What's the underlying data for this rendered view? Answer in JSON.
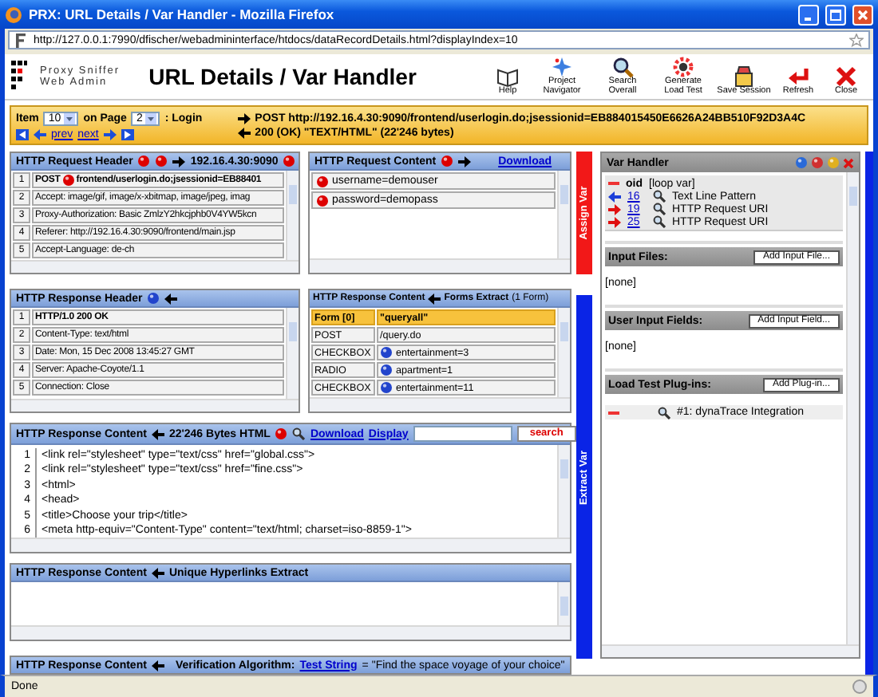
{
  "window": {
    "title": "PRX: URL Details / Var Handler - Mozilla Firefox"
  },
  "address_bar": {
    "url": "http://127.0.0.1:7990/dfischer/webadmininterface/htdocs/dataRecordDetails.html?displayIndex=10"
  },
  "header": {
    "brand": [
      "Proxy Sniffer",
      "Web Admin"
    ],
    "title": "URL Details / Var Handler",
    "tools": [
      {
        "label": "Help"
      },
      {
        "label": "Project Navigator"
      },
      {
        "label": "Search Overall"
      },
      {
        "label": "Generate Load Test"
      },
      {
        "label": "Save Session"
      },
      {
        "label": "Refresh"
      },
      {
        "label": "Close"
      }
    ]
  },
  "item_bar": {
    "item_label": "Item",
    "item_value": "10",
    "page_label": "on Page",
    "page_value": "2",
    "page_name": ": Login",
    "prev": "prev",
    "next": "next",
    "request": "POST http://192.16.4.30:9090/frontend/userlogin.do;jsessionid=EB884015450E6626A24BB510F92D3A4C",
    "response": "200 (OK) \"TEXT/HTML\" (22'246 bytes)"
  },
  "request_header": {
    "title": "HTTP Request Header",
    "host": "192.16.4.30:9090",
    "rows": [
      {
        "number": "1",
        "kind": "request-line",
        "method": "POST",
        "text": "frontend/userlogin.do;jsessionid=EB88401"
      },
      {
        "number": "2",
        "kind": "plain",
        "text": "Accept: image/gif, image/x-xbitmap, image/jpeg, imag"
      },
      {
        "number": "3",
        "kind": "plain",
        "text": "Proxy-Authorization: Basic ZmlzY2hkcjphb0V4YW5kcn"
      },
      {
        "number": "4",
        "kind": "plain",
        "text": "Referer: http://192.16.4.30:9090/frontend/main.jsp"
      },
      {
        "number": "5",
        "kind": "plain",
        "text": "Accept-Language: de-ch"
      }
    ]
  },
  "request_content": {
    "title": "HTTP Request Content",
    "download": "Download",
    "params": [
      {
        "text": "username=demouser"
      },
      {
        "text": "password=demopass"
      }
    ]
  },
  "side_strips": {
    "assign": "Assign Var",
    "extract": "Extract Var"
  },
  "response_header": {
    "title": "HTTP Response Header",
    "rows": [
      {
        "number": "1",
        "kind": "status-line",
        "text": "HTTP/1.0 200 OK"
      },
      {
        "number": "2",
        "kind": "plain",
        "text": "Content-Type: text/html"
      },
      {
        "number": "3",
        "kind": "plain",
        "text": "Date: Mon, 15 Dec 2008 13:45:27 GMT"
      },
      {
        "number": "4",
        "kind": "plain",
        "text": "Server: Apache-Coyote/1.1"
      },
      {
        "number": "5",
        "kind": "plain",
        "text": "Connection: Close"
      }
    ]
  },
  "forms": {
    "title": "HTTP Response Content",
    "subtitle": "Forms Extract",
    "count": "(1 Form)",
    "form": "Form [0]",
    "form_name": "\"queryall\"",
    "rows": [
      {
        "type": "POST",
        "kind": "action",
        "value": "/query.do"
      },
      {
        "type": "CHECKBOX",
        "kind": "field",
        "value": "entertainment=3"
      },
      {
        "type": "RADIO",
        "kind": "field",
        "value": "apartment=1"
      },
      {
        "type": "CHECKBOX",
        "kind": "field",
        "value": "entertainment=11"
      }
    ]
  },
  "content": {
    "title": "HTTP Response Content",
    "size": "22'246 Bytes HTML",
    "links": [
      "Download",
      "Display"
    ],
    "search_button": "search",
    "lines": [
      {
        "number": "1",
        "text": "<link rel=\"stylesheet\" type=\"text/css\" href=\"global.css\">"
      },
      {
        "number": "2",
        "text": "<link rel=\"stylesheet\" type=\"text/css\" href=\"fine.css\">"
      },
      {
        "number": "3",
        "text": "<html>"
      },
      {
        "number": "4",
        "text": "<head>"
      },
      {
        "number": "5",
        "text": "<title>Choose your trip</title>"
      },
      {
        "number": "6",
        "text": "<meta http-equiv=\"Content-Type\" content=\"text/html; charset=iso-8859-1\">"
      }
    ]
  },
  "hyperlinks": {
    "title": "HTTP Response Content",
    "subtitle": "Unique Hyperlinks Extract"
  },
  "verification": {
    "title": "HTTP Response Content",
    "label": "Verification Algorithm:",
    "link": "Test String",
    "value": "= \"Find the space voyage of your choice\""
  },
  "var_handler": {
    "title": "Var Handler",
    "vars": [
      {
        "kind": "loop",
        "name": "oid",
        "label": "[loop var]"
      },
      {
        "kind": "extract",
        "name": "16",
        "label": "Text Line Pattern"
      },
      {
        "kind": "assign",
        "name": "19",
        "label": "HTTP Request URI"
      },
      {
        "kind": "assign",
        "name": "25",
        "label": "HTTP Request URI"
      }
    ],
    "sections": [
      {
        "title": "Input Files:",
        "button": "Add Input File...",
        "empty": "[none]"
      },
      {
        "title": "User Input Fields:",
        "button": "Add Input Field...",
        "empty": "[none]"
      },
      {
        "title": "Load Test Plug-ins:",
        "button": "Add Plug-in...",
        "items": [
          {
            "label": "#1: dynaTrace Integration"
          }
        ]
      }
    ]
  },
  "status_bar": {
    "text": "Done"
  }
}
